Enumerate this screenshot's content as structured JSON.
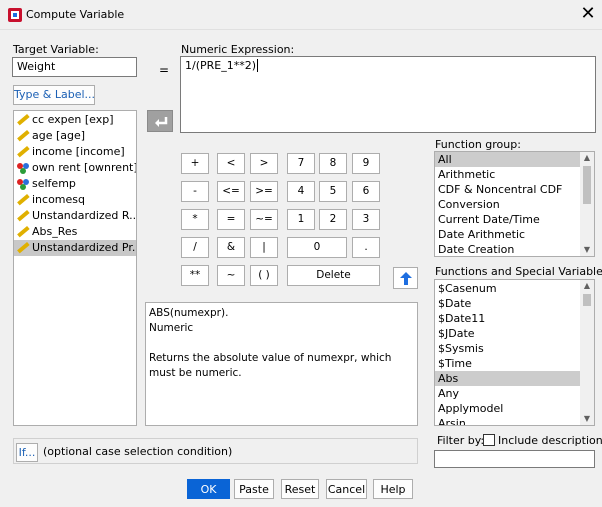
{
  "window": {
    "title": "Compute Variable",
    "close_glyph": "✕"
  },
  "target_variable": {
    "label": "Target Variable:",
    "value": "Weight"
  },
  "equals": "=",
  "numeric_expression": {
    "label": "Numeric Expression:",
    "value": "1/(PRE_1**2)"
  },
  "type_label_button": "Type & Label...",
  "variables": [
    {
      "label": "cc expen [exp]",
      "icon": "ruler-icon",
      "selected": false
    },
    {
      "label": "age [age]",
      "icon": "ruler-icon",
      "selected": false
    },
    {
      "label": "income [income]",
      "icon": "ruler-icon",
      "selected": false
    },
    {
      "label": "own rent [ownrent]",
      "icon": "nominal-icon",
      "selected": false
    },
    {
      "label": "selfemp",
      "icon": "nominal-icon",
      "selected": false
    },
    {
      "label": "incomesq",
      "icon": "ruler-icon",
      "selected": false
    },
    {
      "label": "Unstandardized R...",
      "icon": "ruler-icon",
      "selected": false
    },
    {
      "label": "Abs_Res",
      "icon": "ruler-icon",
      "selected": false
    },
    {
      "label": "Unstandardized Pr...",
      "icon": "ruler-icon",
      "selected": true
    }
  ],
  "keypad": {
    "plus": "+",
    "lt": "<",
    "gt": ">",
    "k7": "7",
    "k8": "8",
    "k9": "9",
    "minus": "-",
    "le": "<=",
    "ge": ">=",
    "k4": "4",
    "k5": "5",
    "k6": "6",
    "mult": "*",
    "eq": "=",
    "ne": "~=",
    "k1": "1",
    "k2": "2",
    "k3": "3",
    "div": "/",
    "and": "&",
    "or": "|",
    "k0": "0",
    "dot": ".",
    "pow": "**",
    "not": "~",
    "paren": "( )",
    "delete": "Delete"
  },
  "function_help": {
    "signature": "ABS(numexpr).",
    "type": "Numeric",
    "description": "Returns the absolute value of numexpr, which must be numeric."
  },
  "function_group": {
    "label": "Function group:",
    "items": [
      "All",
      "Arithmetic",
      "CDF & Noncentral CDF",
      "Conversion",
      "Current Date/Time",
      "Date Arithmetic",
      "Date Creation"
    ],
    "selected_index": 0
  },
  "functions": {
    "label": "Functions and Special Variables:",
    "items": [
      "$Casenum",
      "$Date",
      "$Date11",
      "$JDate",
      "$Sysmis",
      "$Time",
      "Abs",
      "Any",
      "Applymodel",
      "Arsin"
    ],
    "selected_index": 6
  },
  "filter": {
    "label": "Filter by:",
    "checkbox_label": "Include description",
    "value": ""
  },
  "if_button": "If...",
  "if_text": "(optional case selection condition)",
  "buttons": {
    "ok": "OK",
    "paste": "Paste",
    "reset": "Reset",
    "cancel": "Cancel",
    "help": "Help"
  },
  "colors": {
    "accent": "#0a64d6",
    "up_arrow": "#1e6ee0",
    "selection": "#cccccc"
  }
}
